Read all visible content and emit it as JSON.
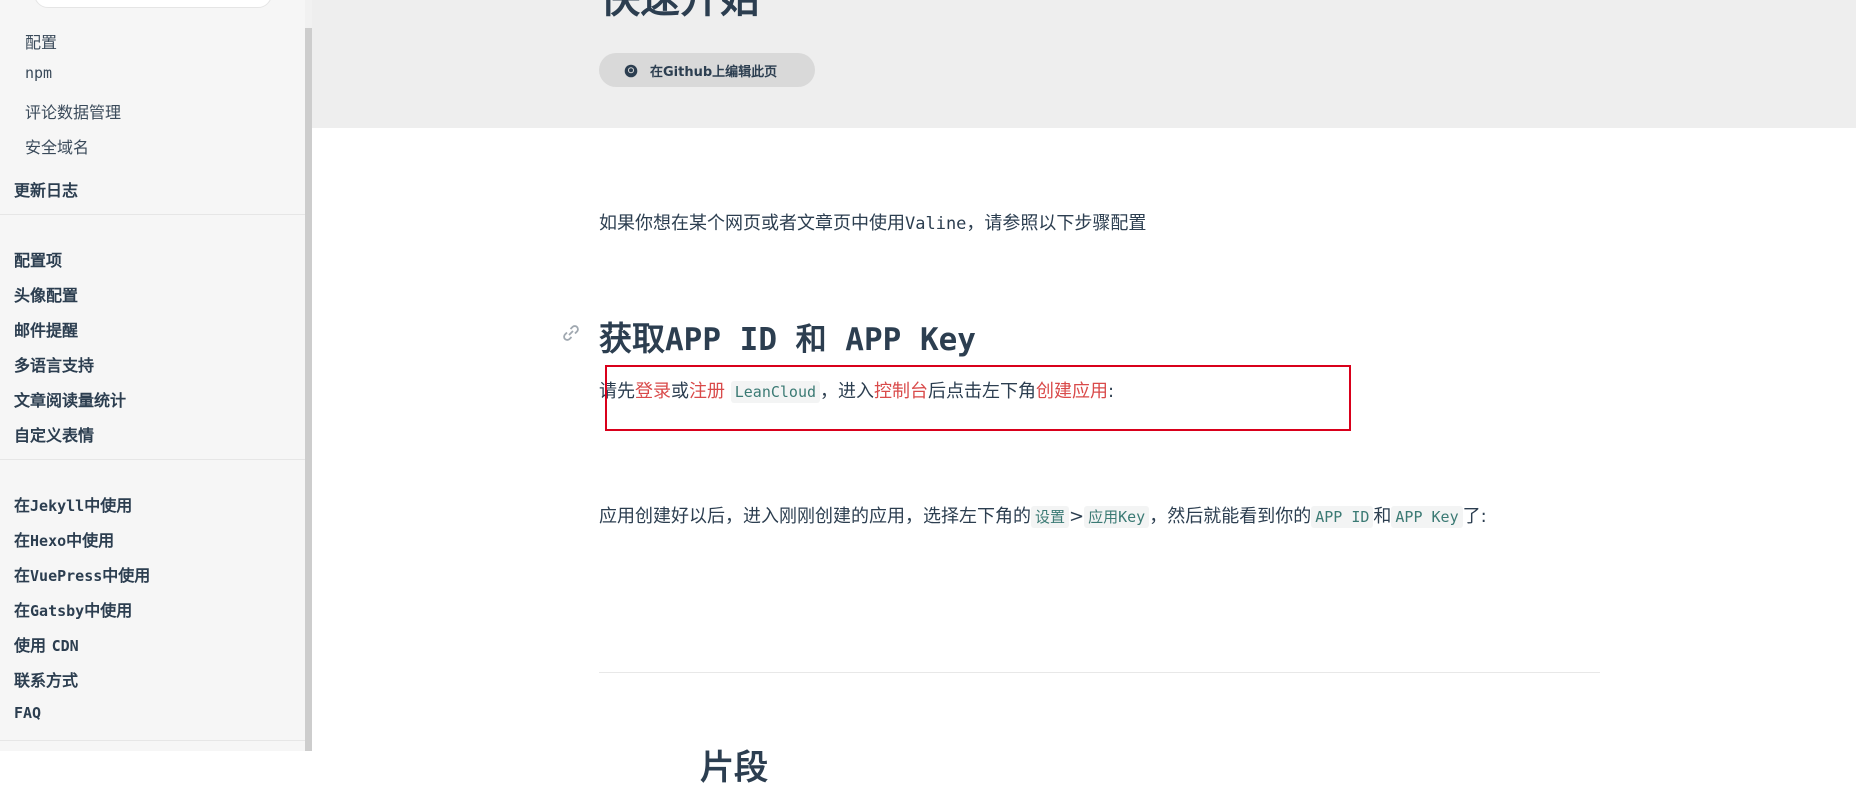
{
  "sidebar": {
    "sub_items": [
      {
        "label": "配置"
      },
      {
        "label": "npm"
      },
      {
        "label": "评论数据管理"
      },
      {
        "label": "安全域名"
      }
    ],
    "changelog": "更新日志",
    "group2": [
      "配置项",
      "头像配置",
      "邮件提醒",
      "多语言支持",
      "文章阅读量统计",
      "自定义表情"
    ],
    "group3": {
      "jekyll": {
        "pre": "在",
        "mono": "Jekyll",
        "post": "中使用"
      },
      "hexo": {
        "pre": "在",
        "mono": "Hexo",
        "post": "中使用"
      },
      "vuepress": {
        "pre": "在",
        "mono": "VuePress",
        "post": "中使用"
      },
      "gatsby": {
        "pre": "在",
        "mono": "Gatsby",
        "post": "中使用"
      },
      "cdn": {
        "pre": "使用 ",
        "mono": "CDN"
      },
      "contact": "联系方式",
      "faq": "FAQ"
    }
  },
  "hero": {
    "title": "快速开始",
    "edit_label": "在Github上编辑此页"
  },
  "content": {
    "intro": {
      "pre": "如果你想在某个网页或者文章页中使用",
      "mono": "Valine",
      "post": "，请参照以下步骤配置"
    },
    "heading": {
      "pre": "获取",
      "mono": "APP ID 和 APP Key"
    },
    "step1": {
      "pre": "请先",
      "login": "登录",
      "or": "或",
      "register": "注册",
      "code": "LeanCloud",
      "mid": "，进入",
      "console": "控制台",
      "after": "后点击左下角",
      "create": "创建应用",
      "end": ":"
    },
    "step2": {
      "pre": "应用创建好以后，进入刚刚创建的应用，选择左下角的",
      "code1": "设置",
      "gt": ">",
      "code2": "应用Key",
      "mid": "，然后就能看到你的",
      "code3": "APP ID",
      "and": "和",
      "code4": "APP Key",
      "end": "了:"
    },
    "next_heading": "片段"
  },
  "colors": {
    "accent": "#d94a4a",
    "text": "#2c3e50",
    "highlight": "#d9001b"
  }
}
